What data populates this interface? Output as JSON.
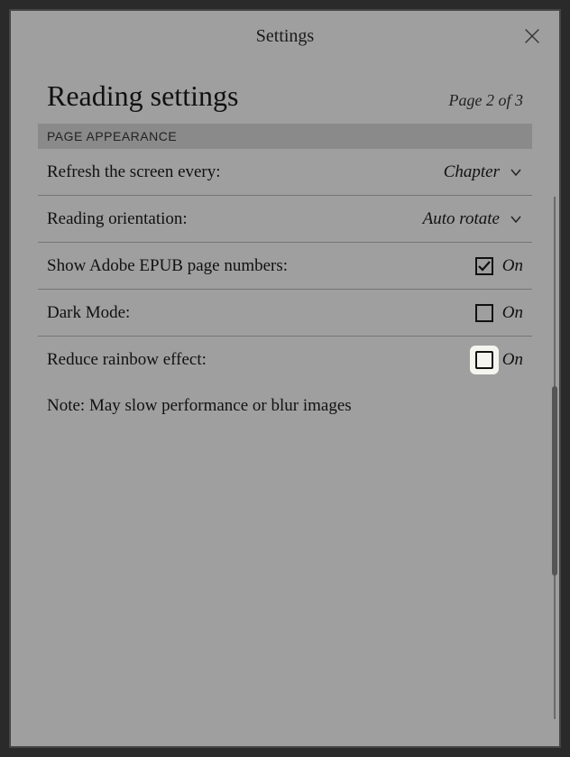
{
  "header": {
    "title": "Settings"
  },
  "page": {
    "title": "Reading settings",
    "indicator": "Page 2 of 3"
  },
  "section": {
    "header": "PAGE APPEARANCE"
  },
  "rows": {
    "refresh": {
      "label": "Refresh the screen every:",
      "value": "Chapter"
    },
    "orientation": {
      "label": "Reading orientation:",
      "value": "Auto rotate"
    },
    "adobe": {
      "label": "Show Adobe EPUB page numbers:",
      "state": "On",
      "checked": true
    },
    "dark": {
      "label": "Dark Mode:",
      "state": "On",
      "checked": false
    },
    "rainbow": {
      "label": "Reduce rainbow effect:",
      "state": "On",
      "checked": false
    }
  },
  "note": "Note: May slow performance or blur images"
}
